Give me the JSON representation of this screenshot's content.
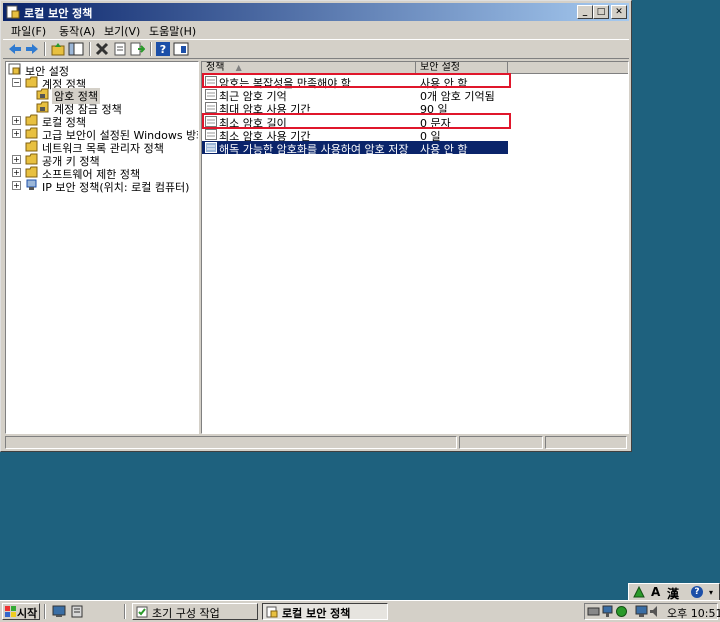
{
  "window": {
    "title": "로컬 보안 정책"
  },
  "menu": [
    "파일(F)",
    "동작(A)",
    "보기(V)",
    "도움말(H)"
  ],
  "tree": {
    "root": "보안 설정",
    "items": [
      {
        "label": "계정 정책",
        "level": 1,
        "expanded": true
      },
      {
        "label": "암호 정책",
        "level": 2,
        "selected": true
      },
      {
        "label": "계정 잠금 정책",
        "level": 2
      },
      {
        "label": "로컬 정책",
        "level": 1
      },
      {
        "label": "고급 보안이 설정된 Windows 방화벽",
        "level": 1
      },
      {
        "label": "네트워크 목록 관리자 정책",
        "level": 1
      },
      {
        "label": "공개 키 정책",
        "level": 1
      },
      {
        "label": "소프트웨어 제한 정책",
        "level": 1
      },
      {
        "label": "IP 보안 정책(위치: 로컬 컴퓨터)",
        "level": 1
      }
    ]
  },
  "list": {
    "col_policy": "정책",
    "col_setting": "보안 설정",
    "rows": [
      {
        "name": "암호는 복잡성을 만족해야 함",
        "value": "사용 안 함"
      },
      {
        "name": "최근 암호 기억",
        "value": "0개 암호 기억됨"
      },
      {
        "name": "최대 암호 사용 기간",
        "value": "90 일"
      },
      {
        "name": "최소 암호 길이",
        "value": "0 문자"
      },
      {
        "name": "최소 암호 사용 기간",
        "value": "0 일"
      },
      {
        "name": "해독 가능한 암호화를 사용하여 암호 저장",
        "value": "사용 안 함"
      }
    ]
  },
  "taskbar": {
    "start": "시작",
    "tasks": [
      "초기 구성 작업",
      "로컬 보안 정책"
    ],
    "clock": "오후 10:51"
  },
  "langbar": {
    "mode": "A",
    "hanja": "漢",
    "help": "?"
  },
  "colors": {
    "desktop": "#1e617e",
    "highlight": "#e0162b",
    "selection": "#0a246a"
  }
}
